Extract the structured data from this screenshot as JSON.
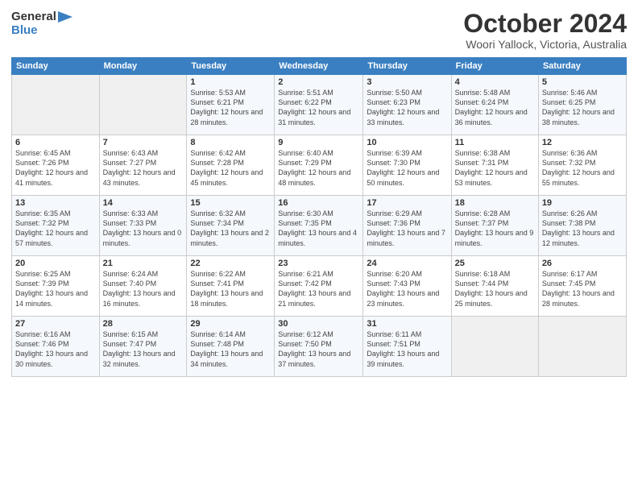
{
  "header": {
    "logo": {
      "general": "General",
      "blue": "Blue"
    },
    "title": "October 2024",
    "location": "Woori Yallock, Victoria, Australia"
  },
  "calendar": {
    "weekdays": [
      "Sunday",
      "Monday",
      "Tuesday",
      "Wednesday",
      "Thursday",
      "Friday",
      "Saturday"
    ],
    "weeks": [
      [
        {
          "day": null
        },
        {
          "day": null
        },
        {
          "day": 1,
          "sunrise": "Sunrise: 5:53 AM",
          "sunset": "Sunset: 6:21 PM",
          "daylight": "Daylight: 12 hours and 28 minutes."
        },
        {
          "day": 2,
          "sunrise": "Sunrise: 5:51 AM",
          "sunset": "Sunset: 6:22 PM",
          "daylight": "Daylight: 12 hours and 31 minutes."
        },
        {
          "day": 3,
          "sunrise": "Sunrise: 5:50 AM",
          "sunset": "Sunset: 6:23 PM",
          "daylight": "Daylight: 12 hours and 33 minutes."
        },
        {
          "day": 4,
          "sunrise": "Sunrise: 5:48 AM",
          "sunset": "Sunset: 6:24 PM",
          "daylight": "Daylight: 12 hours and 36 minutes."
        },
        {
          "day": 5,
          "sunrise": "Sunrise: 5:46 AM",
          "sunset": "Sunset: 6:25 PM",
          "daylight": "Daylight: 12 hours and 38 minutes."
        }
      ],
      [
        {
          "day": 6,
          "sunrise": "Sunrise: 6:45 AM",
          "sunset": "Sunset: 7:26 PM",
          "daylight": "Daylight: 12 hours and 41 minutes."
        },
        {
          "day": 7,
          "sunrise": "Sunrise: 6:43 AM",
          "sunset": "Sunset: 7:27 PM",
          "daylight": "Daylight: 12 hours and 43 minutes."
        },
        {
          "day": 8,
          "sunrise": "Sunrise: 6:42 AM",
          "sunset": "Sunset: 7:28 PM",
          "daylight": "Daylight: 12 hours and 45 minutes."
        },
        {
          "day": 9,
          "sunrise": "Sunrise: 6:40 AM",
          "sunset": "Sunset: 7:29 PM",
          "daylight": "Daylight: 12 hours and 48 minutes."
        },
        {
          "day": 10,
          "sunrise": "Sunrise: 6:39 AM",
          "sunset": "Sunset: 7:30 PM",
          "daylight": "Daylight: 12 hours and 50 minutes."
        },
        {
          "day": 11,
          "sunrise": "Sunrise: 6:38 AM",
          "sunset": "Sunset: 7:31 PM",
          "daylight": "Daylight: 12 hours and 53 minutes."
        },
        {
          "day": 12,
          "sunrise": "Sunrise: 6:36 AM",
          "sunset": "Sunset: 7:32 PM",
          "daylight": "Daylight: 12 hours and 55 minutes."
        }
      ],
      [
        {
          "day": 13,
          "sunrise": "Sunrise: 6:35 AM",
          "sunset": "Sunset: 7:32 PM",
          "daylight": "Daylight: 12 hours and 57 minutes."
        },
        {
          "day": 14,
          "sunrise": "Sunrise: 6:33 AM",
          "sunset": "Sunset: 7:33 PM",
          "daylight": "Daylight: 13 hours and 0 minutes."
        },
        {
          "day": 15,
          "sunrise": "Sunrise: 6:32 AM",
          "sunset": "Sunset: 7:34 PM",
          "daylight": "Daylight: 13 hours and 2 minutes."
        },
        {
          "day": 16,
          "sunrise": "Sunrise: 6:30 AM",
          "sunset": "Sunset: 7:35 PM",
          "daylight": "Daylight: 13 hours and 4 minutes."
        },
        {
          "day": 17,
          "sunrise": "Sunrise: 6:29 AM",
          "sunset": "Sunset: 7:36 PM",
          "daylight": "Daylight: 13 hours and 7 minutes."
        },
        {
          "day": 18,
          "sunrise": "Sunrise: 6:28 AM",
          "sunset": "Sunset: 7:37 PM",
          "daylight": "Daylight: 13 hours and 9 minutes."
        },
        {
          "day": 19,
          "sunrise": "Sunrise: 6:26 AM",
          "sunset": "Sunset: 7:38 PM",
          "daylight": "Daylight: 13 hours and 12 minutes."
        }
      ],
      [
        {
          "day": 20,
          "sunrise": "Sunrise: 6:25 AM",
          "sunset": "Sunset: 7:39 PM",
          "daylight": "Daylight: 13 hours and 14 minutes."
        },
        {
          "day": 21,
          "sunrise": "Sunrise: 6:24 AM",
          "sunset": "Sunset: 7:40 PM",
          "daylight": "Daylight: 13 hours and 16 minutes."
        },
        {
          "day": 22,
          "sunrise": "Sunrise: 6:22 AM",
          "sunset": "Sunset: 7:41 PM",
          "daylight": "Daylight: 13 hours and 18 minutes."
        },
        {
          "day": 23,
          "sunrise": "Sunrise: 6:21 AM",
          "sunset": "Sunset: 7:42 PM",
          "daylight": "Daylight: 13 hours and 21 minutes."
        },
        {
          "day": 24,
          "sunrise": "Sunrise: 6:20 AM",
          "sunset": "Sunset: 7:43 PM",
          "daylight": "Daylight: 13 hours and 23 minutes."
        },
        {
          "day": 25,
          "sunrise": "Sunrise: 6:18 AM",
          "sunset": "Sunset: 7:44 PM",
          "daylight": "Daylight: 13 hours and 25 minutes."
        },
        {
          "day": 26,
          "sunrise": "Sunrise: 6:17 AM",
          "sunset": "Sunset: 7:45 PM",
          "daylight": "Daylight: 13 hours and 28 minutes."
        }
      ],
      [
        {
          "day": 27,
          "sunrise": "Sunrise: 6:16 AM",
          "sunset": "Sunset: 7:46 PM",
          "daylight": "Daylight: 13 hours and 30 minutes."
        },
        {
          "day": 28,
          "sunrise": "Sunrise: 6:15 AM",
          "sunset": "Sunset: 7:47 PM",
          "daylight": "Daylight: 13 hours and 32 minutes."
        },
        {
          "day": 29,
          "sunrise": "Sunrise: 6:14 AM",
          "sunset": "Sunset: 7:48 PM",
          "daylight": "Daylight: 13 hours and 34 minutes."
        },
        {
          "day": 30,
          "sunrise": "Sunrise: 6:12 AM",
          "sunset": "Sunset: 7:50 PM",
          "daylight": "Daylight: 13 hours and 37 minutes."
        },
        {
          "day": 31,
          "sunrise": "Sunrise: 6:11 AM",
          "sunset": "Sunset: 7:51 PM",
          "daylight": "Daylight: 13 hours and 39 minutes."
        },
        {
          "day": null
        },
        {
          "day": null
        }
      ]
    ]
  }
}
